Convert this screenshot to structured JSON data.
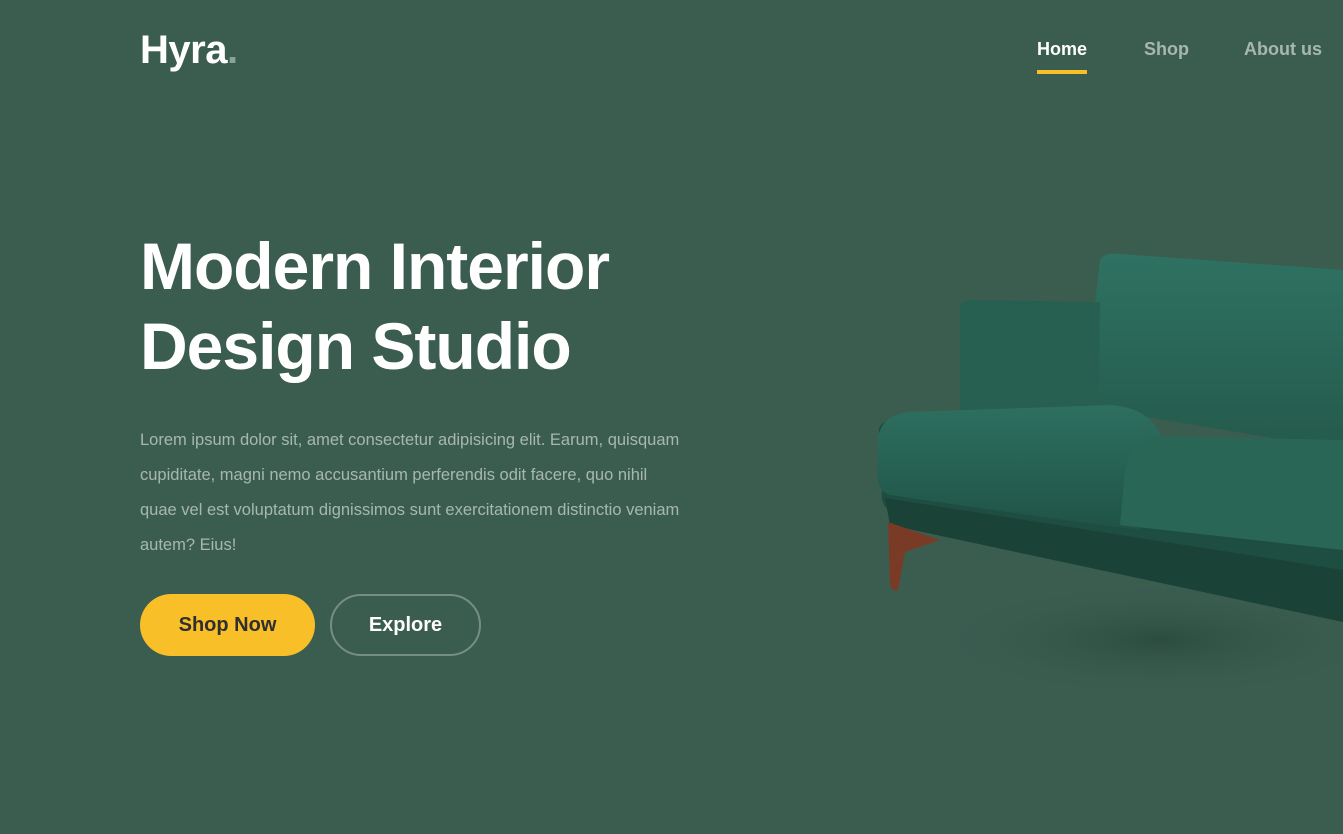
{
  "brand": {
    "name": "Hyra",
    "dot": "."
  },
  "nav": {
    "items": [
      {
        "label": "Home",
        "active": true
      },
      {
        "label": "Shop",
        "active": false
      },
      {
        "label": "About us",
        "active": false
      }
    ]
  },
  "hero": {
    "title_line1": "Modern Interior",
    "title_line2": "Design Studio",
    "description": "Lorem ipsum dolor sit, amet consectetur adipisicing elit. Earum, quisquam cupiditate, magni nemo accusantium perferendis odit facere, quo nihil quae vel est voluptatum dignissimos sunt exercitationem distinctio veniam autem? Eius!",
    "primary_button": "Shop Now",
    "secondary_button": "Explore",
    "image_icon": "sofa-image"
  },
  "colors": {
    "background": "#3b5d50",
    "accent": "#f9bf29",
    "sofa": "#2f6b5a",
    "sofa_leg": "#7a3b26"
  }
}
